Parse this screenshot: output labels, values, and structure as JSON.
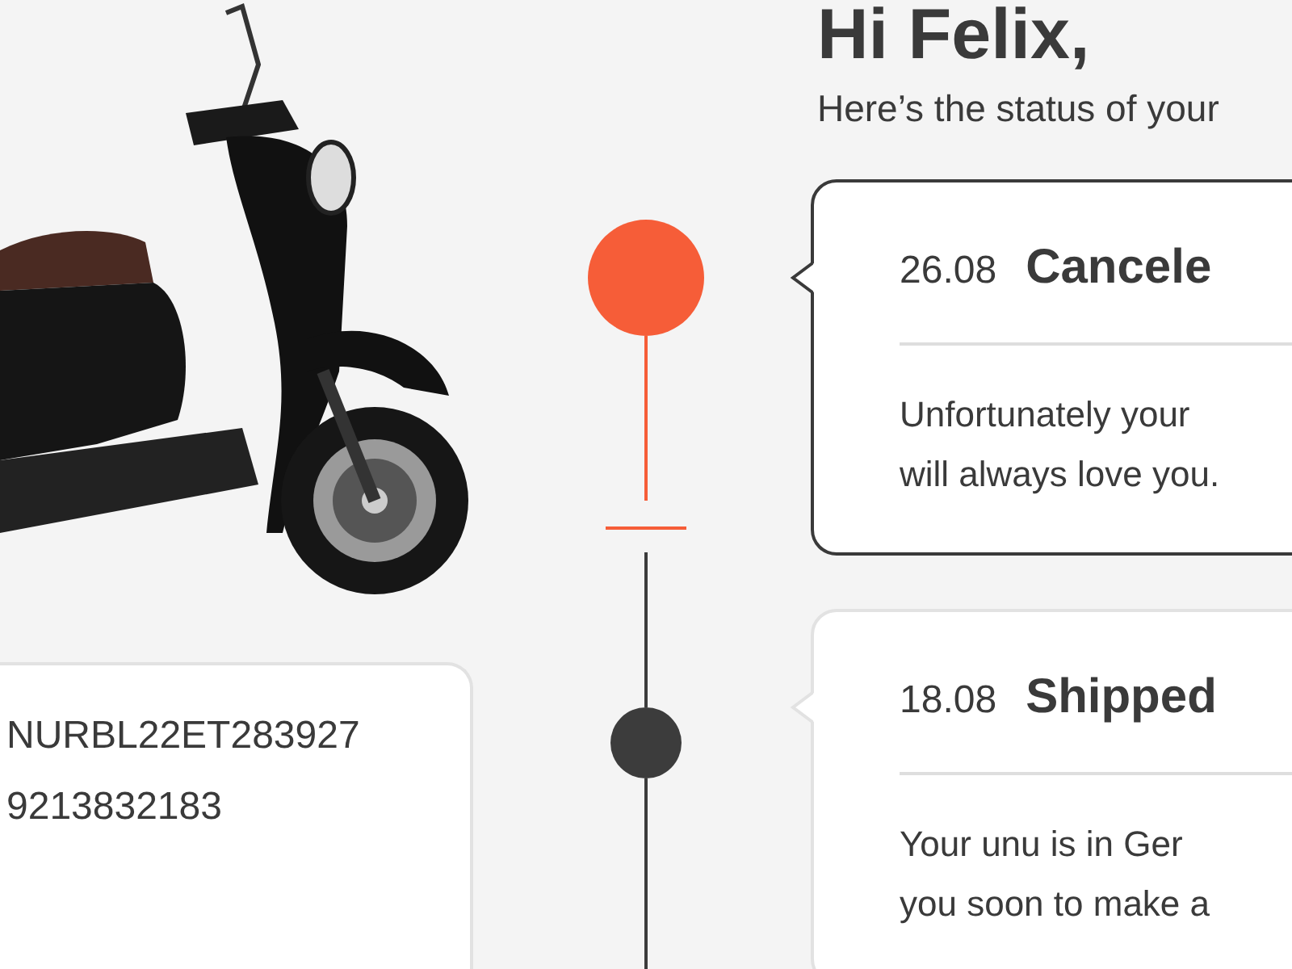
{
  "greeting": {
    "title": "Hi Felix,",
    "subtitle": "Here’s the status of your"
  },
  "scooter_card": {
    "lines": [
      "NURBL22ET283927",
      "9213832183"
    ]
  },
  "timeline": [
    {
      "kind": "canceled",
      "color": "#f65d38",
      "selected": true,
      "date": "26.08",
      "title": "Cancele",
      "body": [
        "Unfortunately your",
        "will always love you."
      ]
    },
    {
      "kind": "shipped",
      "color": "#3c3c3c",
      "selected": false,
      "date": "18.08",
      "title": "Shipped",
      "body": [
        "Your unu is in Ger",
        "you soon to make a"
      ]
    }
  ]
}
